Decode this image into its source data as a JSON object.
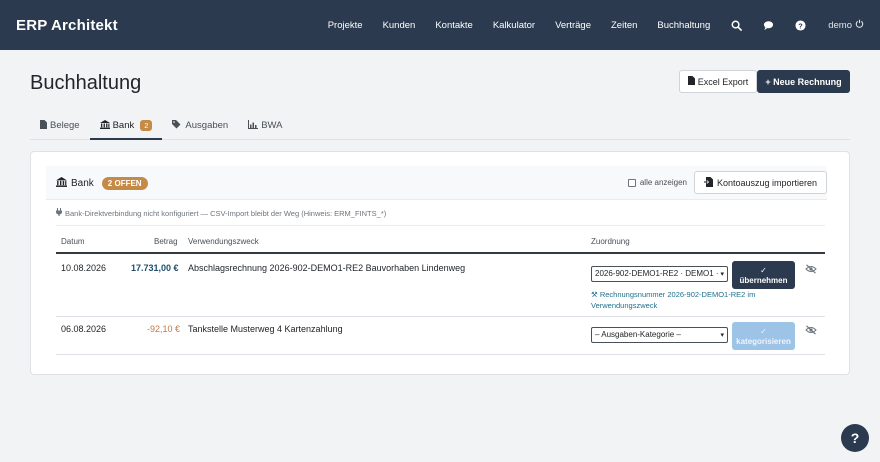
{
  "app": {
    "brand": "ERP Architekt"
  },
  "nav": {
    "items": [
      "Projekte",
      "Kunden",
      "Kontakte",
      "Kalkulator",
      "Verträge",
      "Zeiten",
      "Buchhaltung"
    ],
    "user": "demo"
  },
  "page": {
    "title": "Buchhaltung",
    "excel_label": "Excel Export",
    "new_invoice_label": "+ Neue Rechnung"
  },
  "tabs": [
    {
      "label": "Belege"
    },
    {
      "label": "Bank",
      "badge": "2"
    },
    {
      "label": "Ausgaben"
    },
    {
      "label": "BWA"
    }
  ],
  "bank": {
    "title": "Bank",
    "open_badge": "2 OFFEN",
    "show_all_label": "alle anzeigen",
    "import_label": "Kontoauszug importieren",
    "info": "Bank-Direktverbindung nicht konfiguriert — CSV-Import bleibt der Weg (Hinweis: ERM_FINTS_*)",
    "columns": {
      "date": "Datum",
      "amount": "Betrag",
      "purpose": "Verwendungszweck",
      "assignment": "Zuordnung"
    },
    "rows": [
      {
        "date": "10.08.2026",
        "amount": "17.731,00 €",
        "purpose": "Abschlagsrechnung 2026-902-DEMO1-RE2 Bauvorhaben Lindenweg",
        "select_value": "2026-902-DEMO1-RE2 · DEMO1 ·",
        "action_label": "übernehmen",
        "hint": "Rechnungsnummer 2026-902-DEMO1-RE2 im Verwendungszweck"
      },
      {
        "date": "06.08.2026",
        "amount": "-92,10 €",
        "purpose": "Tankstelle Musterweg 4 Kartenzahlung",
        "select_value": "– Ausgaben-Kategorie –",
        "action_label": "kategorisieren"
      }
    ]
  },
  "help": {
    "label": "?"
  }
}
